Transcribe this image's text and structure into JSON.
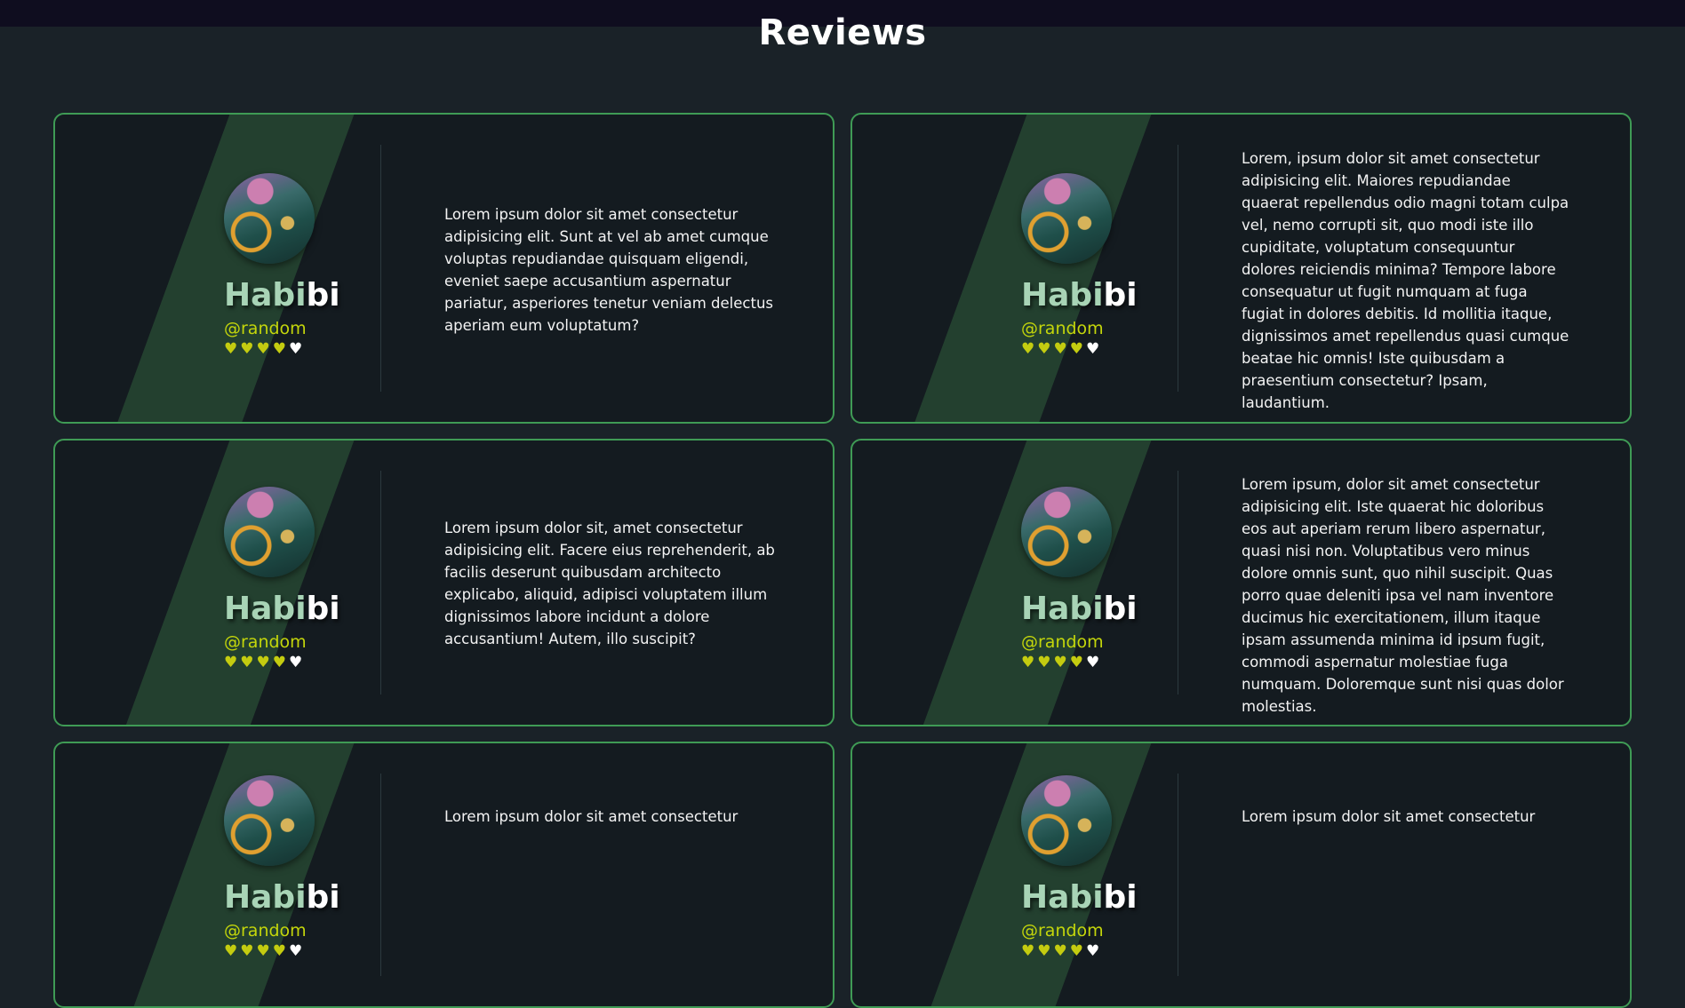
{
  "page": {
    "title": "Reviews"
  },
  "reviews": [
    {
      "name_a": "Habi",
      "name_b": "bi",
      "handle": "@random",
      "hearts": "♥♥♥♥",
      "empty": "♥",
      "text": "Lorem ipsum dolor sit amet consectetur adipisicing elit. Sunt at vel ab amet cumque voluptas repudiandae quisquam eligendi, eveniet saepe accusantium aspernatur pariatur, asperiores tenetur veniam delectus aperiam eum voluptatum?"
    },
    {
      "name_a": "Habi",
      "name_b": "bi",
      "handle": "@random",
      "hearts": "♥♥♥♥",
      "empty": "♥",
      "text": "Lorem, ipsum dolor sit amet consectetur adipisicing elit. Maiores repudiandae quaerat repellendus odio magni totam culpa vel, nemo corrupti sit, quo modi iste illo cupiditate, voluptatum consequuntur dolores reiciendis minima? Tempore labore consequatur ut fugit numquam at fuga fugiat in dolores debitis. Id mollitia itaque, dignissimos amet repellendus quasi cumque beatae hic omnis! Iste quibusdam a praesentium consectetur? Ipsam, laudantium."
    },
    {
      "name_a": "Habi",
      "name_b": "bi",
      "handle": "@random",
      "hearts": "♥♥♥♥",
      "empty": "♥",
      "text": "Lorem ipsum dolor sit, amet consectetur adipisicing elit. Facere eius reprehenderit, ab facilis deserunt quibusdam architecto explicabo, aliquid, adipisci voluptatem illum dignissimos labore incidunt a dolore accusantium! Autem, illo suscipit?"
    },
    {
      "name_a": "Habi",
      "name_b": "bi",
      "handle": "@random",
      "hearts": "♥♥♥♥",
      "empty": "♥",
      "text": "Lorem ipsum, dolor sit amet consectetur adipisicing elit. Iste quaerat hic doloribus eos aut aperiam rerum libero aspernatur, quasi nisi non. Voluptatibus vero minus dolore omnis sunt, quo nihil suscipit. Quas porro quae deleniti ipsa vel nam inventore ducimus hic exercitationem, illum itaque ipsam assumenda minima id ipsum fugit, commodi aspernatur molestiae fuga numquam. Doloremque sunt nisi quas dolor molestias."
    },
    {
      "name_a": "Habi",
      "name_b": "bi",
      "handle": "@random",
      "hearts": "♥♥♥♥",
      "empty": "♥",
      "text": "Lorem ipsum dolor sit amet consectetur"
    },
    {
      "name_a": "Habi",
      "name_b": "bi",
      "handle": "@random",
      "hearts": "♥♥♥♥",
      "empty": "♥",
      "text": "Lorem ipsum dolor sit amet consectetur"
    }
  ]
}
